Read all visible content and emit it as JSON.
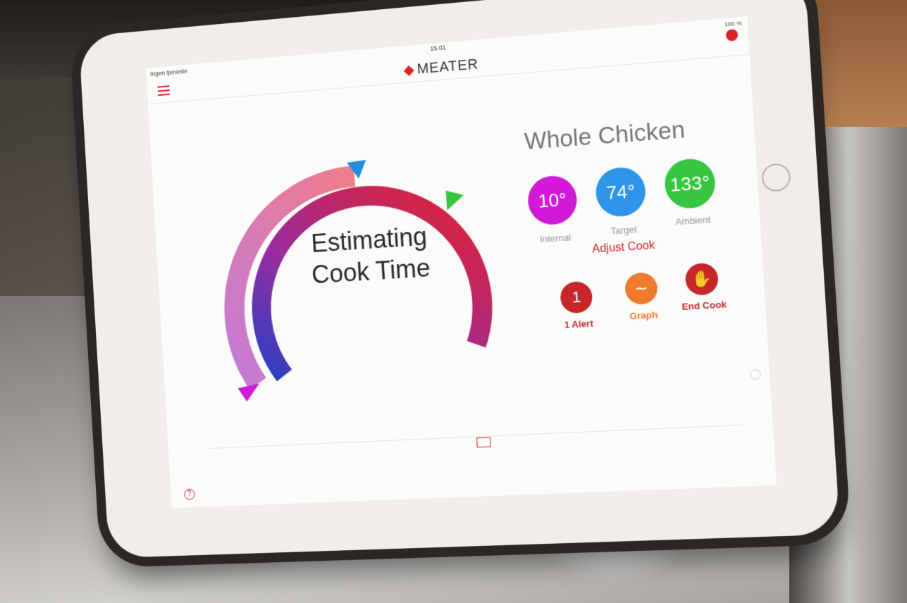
{
  "status": {
    "carrier": "Ingen tjeneste",
    "time": "15.01",
    "battery": "100 %"
  },
  "header": {
    "brand": "MEATER"
  },
  "cook": {
    "title": "Whole Chicken",
    "status": "Estimating Cook Time",
    "internal_value": "10°",
    "internal_label": "Internal",
    "target_value": "74°",
    "target_label": "Target",
    "ambient_value": "133°",
    "ambient_label": "Ambient",
    "adjust_label": "Adjust Cook"
  },
  "actions": {
    "alert_label": "1 Alert",
    "alert_count": "1",
    "graph_label": "Graph",
    "end_label": "End Cook"
  },
  "colors": {
    "brand_red": "#d9232b",
    "internal": "#d219d8",
    "target": "#2f95e8",
    "ambient": "#37c640",
    "graph": "#f07a2b"
  }
}
